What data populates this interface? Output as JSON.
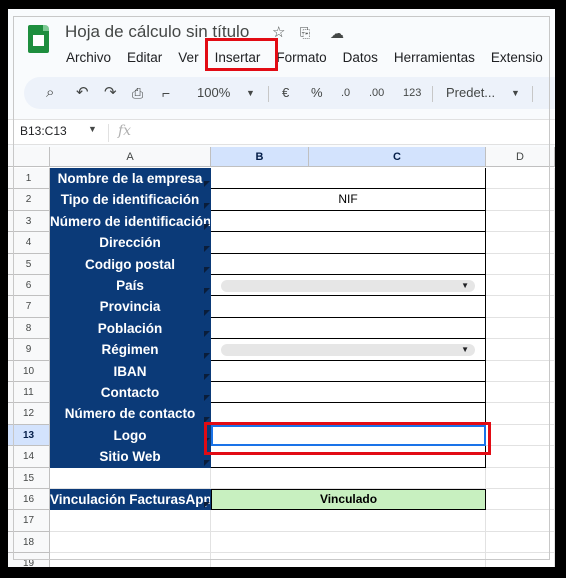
{
  "window": {
    "title": "Hoja de cálculo sin título",
    "title_icons": [
      "star-icon",
      "move-to-folder-icon",
      "cloud-status-icon"
    ]
  },
  "menu": {
    "items": [
      "Archivo",
      "Editar",
      "Ver",
      "Insertar",
      "Formato",
      "Datos",
      "Herramientas",
      "Extensio"
    ],
    "highlighted": "Insertar"
  },
  "toolbar": {
    "zoom": "100%",
    "currency": "€",
    "percent": "%",
    "dec_decrease": ".0",
    "dec_increase": ".00",
    "number_format": "123",
    "font": "Predet..."
  },
  "formula_bar": {
    "name_box": "B13:C13",
    "fx": "fx",
    "value": ""
  },
  "columns": [
    "A",
    "B",
    "C",
    "D"
  ],
  "selected_columns": [
    "B",
    "C"
  ],
  "rows": [
    {
      "n": "1",
      "label": "Nombre de la empresa",
      "value": ""
    },
    {
      "n": "2",
      "label": "Tipo de identificación",
      "value": "NIF"
    },
    {
      "n": "3",
      "label": "Número de identificación",
      "value": ""
    },
    {
      "n": "4",
      "label": "Dirección",
      "value": ""
    },
    {
      "n": "5",
      "label": "Codigo postal",
      "value": ""
    },
    {
      "n": "6",
      "label": "País",
      "value": "",
      "dropdown": true
    },
    {
      "n": "7",
      "label": "Provincia",
      "value": ""
    },
    {
      "n": "8",
      "label": "Población",
      "value": ""
    },
    {
      "n": "9",
      "label": "Régimen",
      "value": "",
      "dropdown": true
    },
    {
      "n": "10",
      "label": "IBAN",
      "value": ""
    },
    {
      "n": "11",
      "label": "Contacto",
      "value": ""
    },
    {
      "n": "12",
      "label": "Número de contacto",
      "value": ""
    },
    {
      "n": "13",
      "label": "Logo",
      "value": ""
    },
    {
      "n": "14",
      "label": "Sitio Web",
      "value": ""
    }
  ],
  "extra_rows": [
    "15",
    "16",
    "17",
    "18",
    "19"
  ],
  "row16": {
    "label": "Vinculación FacturasApp",
    "value": "Vinculado"
  },
  "colors": {
    "label_bg": "#0b3a78",
    "accent_green": "#c8f0c0",
    "highlight_red": "#e20b14",
    "selection_blue": "#1a73e8"
  }
}
